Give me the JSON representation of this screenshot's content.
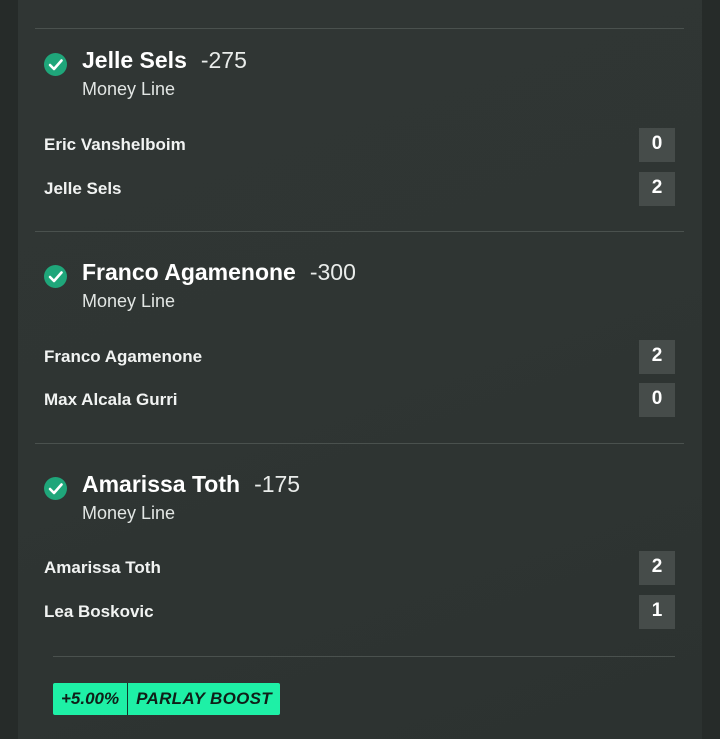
{
  "legs": [
    {
      "pick": "Jelle Sels",
      "odds": "-275",
      "market": "Money Line",
      "players": [
        {
          "name": "Eric Vanshelboim",
          "score": "0"
        },
        {
          "name": "Jelle Sels",
          "score": "2"
        }
      ]
    },
    {
      "pick": "Franco Agamenone",
      "odds": "-300",
      "market": "Money Line",
      "players": [
        {
          "name": "Franco Agamenone",
          "score": "2"
        },
        {
          "name": "Max Alcala Gurri",
          "score": "0"
        }
      ]
    },
    {
      "pick": "Amarissa Toth",
      "odds": "-175",
      "market": "Money Line",
      "players": [
        {
          "name": "Amarissa Toth",
          "score": "2"
        },
        {
          "name": "Lea Boskovic",
          "score": "1"
        }
      ]
    }
  ],
  "boost": {
    "percent": "+5.00%",
    "label": "PARLAY BOOST"
  },
  "colors": {
    "check": "#1fa67a",
    "boost": "#1ef0a6"
  },
  "icons": {
    "leg_status": "check-circle-icon"
  }
}
